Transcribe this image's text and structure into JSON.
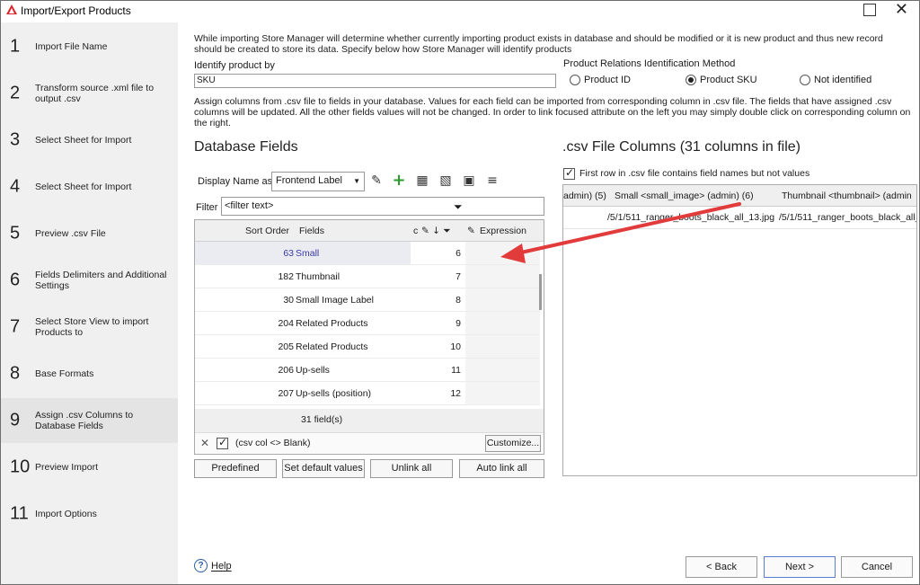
{
  "window": {
    "title": "Import/Export Products",
    "maximize_icon": "maximize-icon",
    "close_glyph": "✕"
  },
  "steps": [
    {
      "num": "1",
      "label": "Import File Name"
    },
    {
      "num": "2",
      "label": "Transform source .xml file to output .csv"
    },
    {
      "num": "3",
      "label": "Select Sheet for Import"
    },
    {
      "num": "4",
      "label": "Select Sheet for Import"
    },
    {
      "num": "5",
      "label": "Preview .csv File"
    },
    {
      "num": "6",
      "label": "Fields Delimiters and Additional Settings"
    },
    {
      "num": "7",
      "label": "Select Store View to import Products to"
    },
    {
      "num": "8",
      "label": "Base Formats"
    },
    {
      "num": "9",
      "label": "Assign .csv Columns to Database Fields"
    },
    {
      "num": "10",
      "label": "Preview Import"
    },
    {
      "num": "11",
      "label": "Import Options"
    }
  ],
  "active_step": "9",
  "intro_text": "While importing Store Manager will determine whether currently importing product exists in database and should be modified or it is new product and thus new record should be created to store its data. Specify below how Store Manager will identify products",
  "identify": {
    "label": "Identify product by",
    "value": "SKU"
  },
  "relations": {
    "label": "Product Relations Identification Method",
    "options": [
      {
        "label": "Product ID",
        "selected": false
      },
      {
        "label": "Product SKU",
        "selected": true
      },
      {
        "label": "Not identified",
        "selected": false
      }
    ]
  },
  "assign_text": "Assign columns from .csv file to fields in your database. Values for each field can be imported from corresponding column in .csv file. The fields that have assigned .csv columns will be updated. All the other fields values will not be changed. In order to link focused attribute on the left you may simply double click on corresponding column on the right.",
  "db_fields": {
    "title": "Database Fields",
    "display_label": "Display Name as",
    "display_value": "Frontend Label",
    "filter_label": "Filter",
    "filter_placeholder": "<filter text>",
    "headers": {
      "sort": "Sort Order",
      "fields": "Fields",
      "col": "c",
      "expression": "Expression"
    },
    "rows": [
      {
        "sort": "63",
        "field": "Small",
        "col": "6",
        "selected": true
      },
      {
        "sort": "182",
        "field": "Thumbnail",
        "col": "7"
      },
      {
        "sort": "30",
        "field": "Small Image Label",
        "col": "8"
      },
      {
        "sort": "204",
        "field": "Related Products",
        "col": "9"
      },
      {
        "sort": "205",
        "field": "Related Products",
        "col": "10"
      },
      {
        "sort": "206",
        "field": "Up-sells",
        "col": "11"
      },
      {
        "sort": "207",
        "field": "Up-sells (position)",
        "col": "12"
      }
    ],
    "count": "31 field(s)",
    "footer_filter": "(csv col <> Blank)",
    "customize": "Customize..."
  },
  "buttons": {
    "predefined": "Predefined",
    "set_default": "Set default values",
    "unlink": "Unlink all",
    "auto_link": "Auto link all"
  },
  "csv": {
    "title": ".csv File Columns (31 columns in file)",
    "first_row_label": "First row in .csv file contains field names but not values",
    "headers": [
      "admin) (5)",
      "Small <small_image> (admin) (6)",
      "Thumbnail <thumbnail> (admin"
    ],
    "row": [
      "",
      "/5/1/511_ranger_boots_black_all_13.jpg",
      "/5/1/511_ranger_boots_black_all_"
    ]
  },
  "footer": {
    "help": "Help",
    "back": "< Back",
    "next": "Next >",
    "cancel": "Cancel"
  },
  "colors": {
    "accent_arrow": "#e23b3b",
    "selected_text": "#3a3aa0",
    "sidebar_bg": "#f0f0f0"
  }
}
